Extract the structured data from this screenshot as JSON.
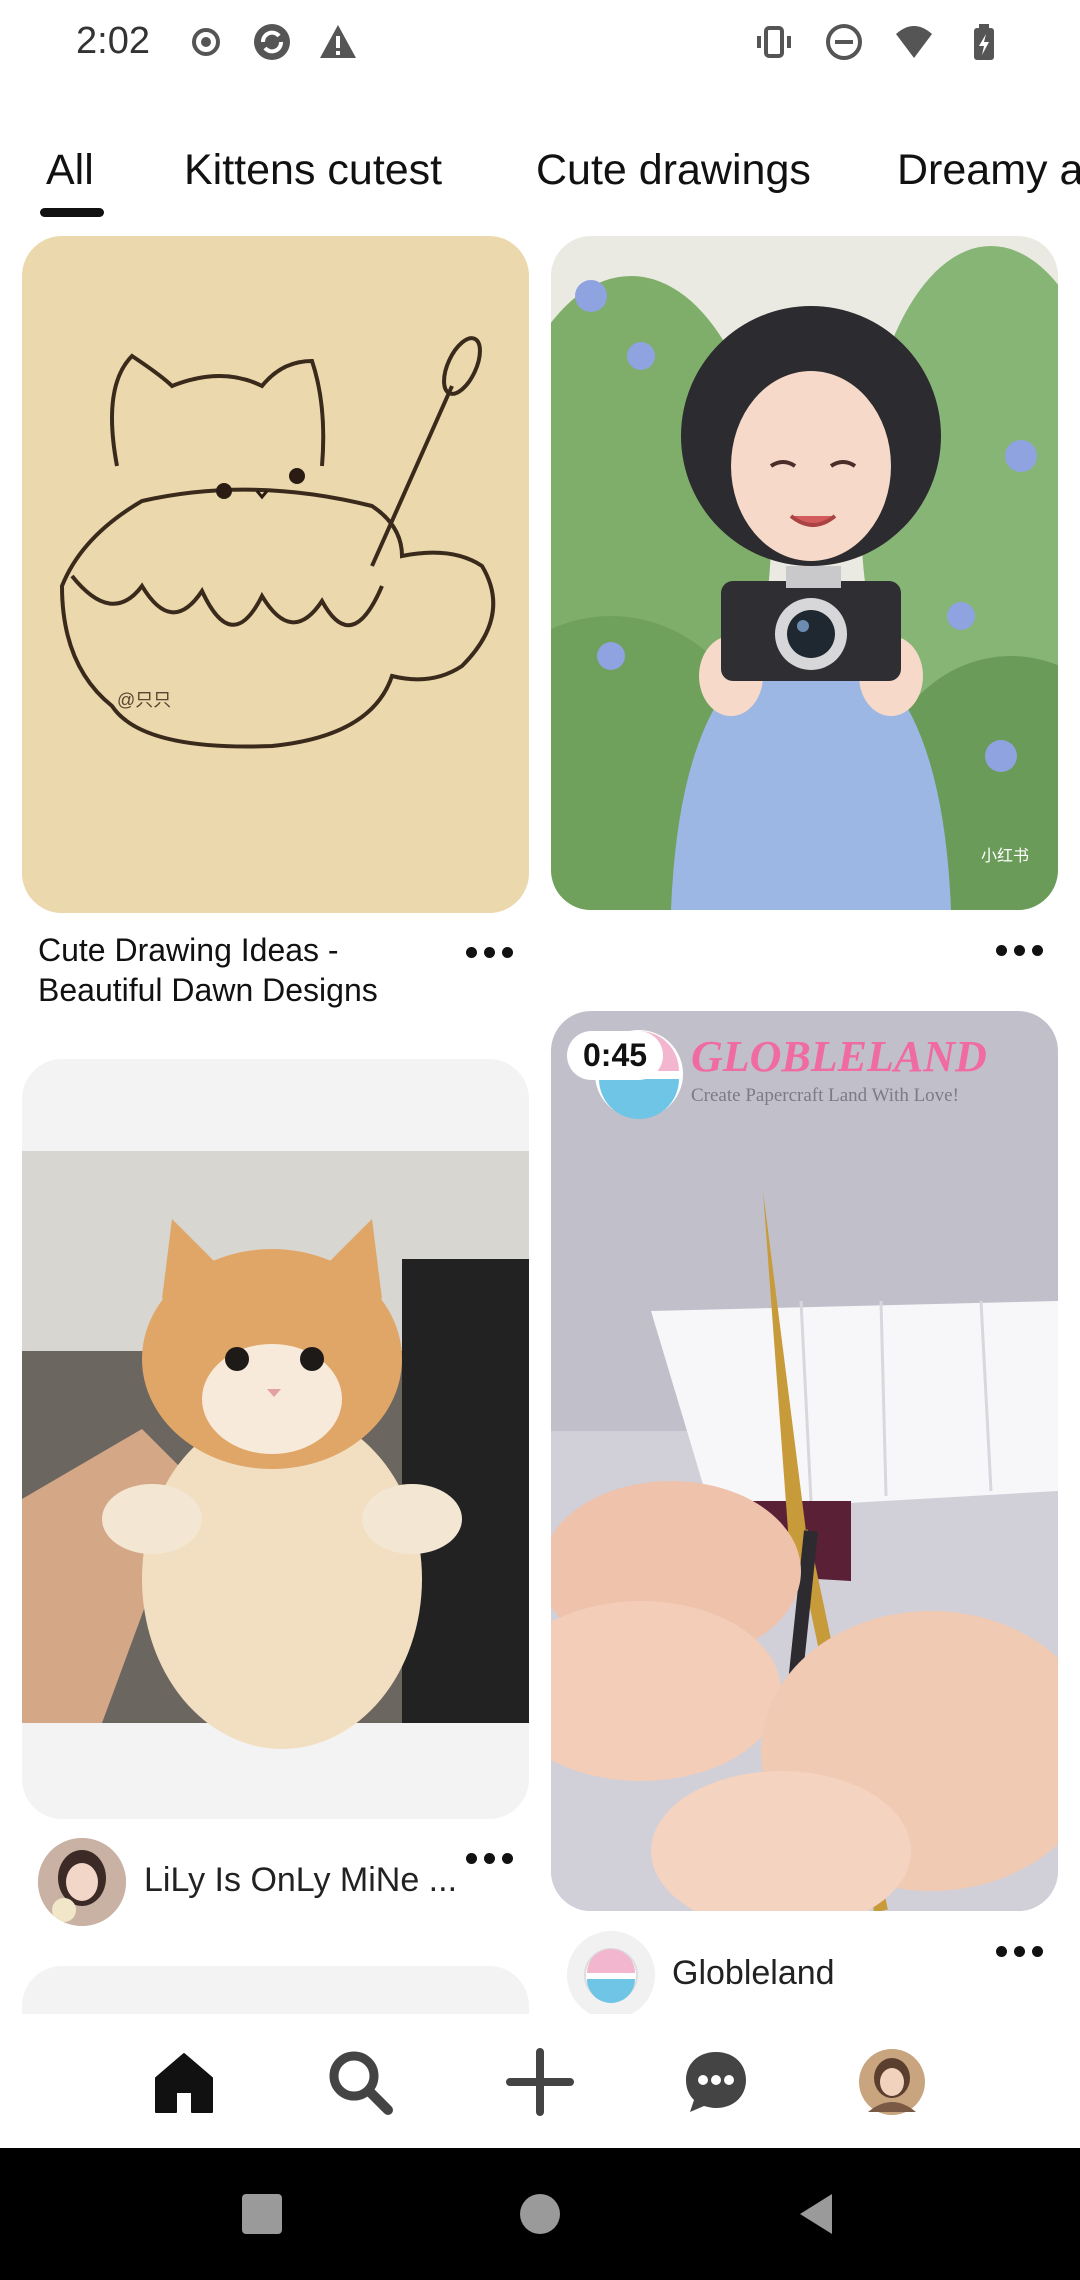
{
  "status_bar": {
    "time": "2:02",
    "left_icons": [
      "record-icon",
      "sync-icon",
      "warning-icon"
    ],
    "right_icons": [
      "vibrate-icon",
      "do-not-disturb-icon",
      "wifi-icon",
      "battery-charging-icon"
    ]
  },
  "tabs": [
    {
      "label": "All",
      "active": true
    },
    {
      "label": "Kittens cutest",
      "active": false
    },
    {
      "label": "Cute drawings",
      "active": false
    },
    {
      "label": "Dreamy a",
      "active": false
    }
  ],
  "pins": {
    "cat_cup": {
      "caption": "Cute Drawing Ideas - Beautiful Dawn Designs",
      "caption_line1": "Cute Drawing Ideas -",
      "caption_line2": "Beautiful Dawn Designs"
    },
    "girl_camera": {
      "caption": ""
    },
    "kitten": {
      "author": "LiLy Is OnLy MiNe ..."
    },
    "globleland": {
      "duration": "0:45",
      "author": "Globleland",
      "overlay_title": "GLOBLELAND",
      "overlay_subtitle": "Create Papercraft Land With Love!"
    }
  },
  "bottom_nav": {
    "items": [
      "home-icon",
      "search-icon",
      "create-icon",
      "messages-icon",
      "profile-avatar"
    ],
    "active": "home-icon"
  },
  "colors": {
    "accent": "#111111",
    "background": "#ffffff",
    "globleland_pink": "#f06aa4",
    "globleland_blue": "#6fc5e5"
  }
}
